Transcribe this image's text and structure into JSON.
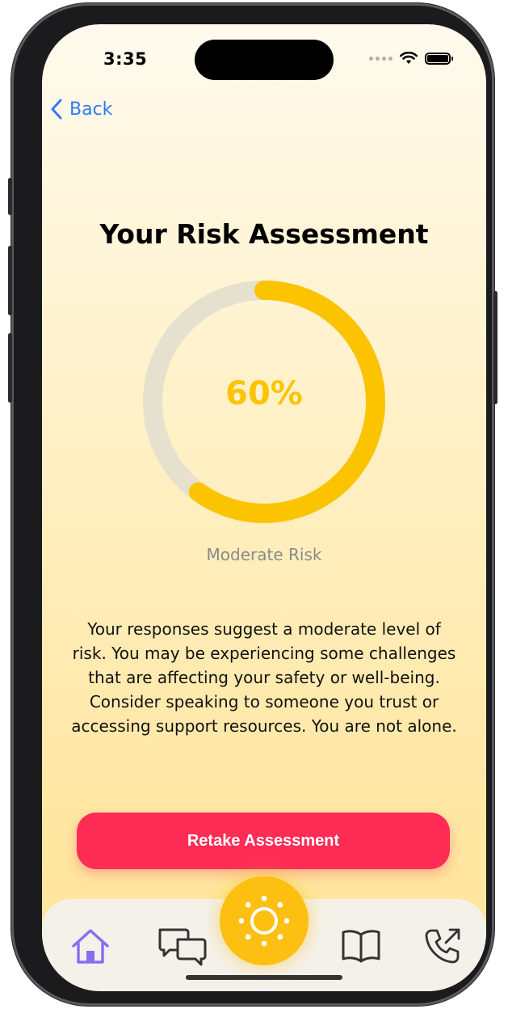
{
  "status": {
    "time": "3:35"
  },
  "nav": {
    "back_label": "Back"
  },
  "assessment": {
    "title": "Your Risk Assessment",
    "percent_label": "60%",
    "percent_value": 60,
    "risk_level": "Moderate Risk",
    "description": "Your responses suggest a moderate level of risk. You may be experiencing some challenges that are affecting your safety or well-being. Consider speaking to someone you trust or accessing support resources. You are not alone."
  },
  "actions": {
    "retake_label": "Retake Assessment"
  },
  "tabs": [
    {
      "icon": "home-icon",
      "active": true
    },
    {
      "icon": "chat-bubbles-icon",
      "active": false
    },
    {
      "icon": "sun-icon",
      "active": false
    },
    {
      "icon": "book-icon",
      "active": false
    },
    {
      "icon": "phone-outgoing-icon",
      "active": false
    }
  ],
  "colors": {
    "accent_yellow": "#fcc400",
    "ring_track": "#e6e0cf",
    "link_blue": "#2f7cf6",
    "button_red": "#ff2c55",
    "tab_active": "#8b6cf0",
    "tab_inactive": "#333333"
  }
}
